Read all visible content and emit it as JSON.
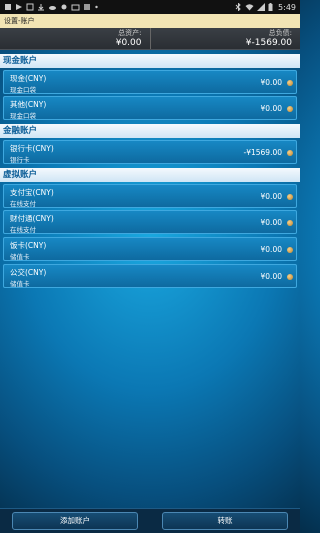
{
  "status_bar": {
    "time": "5:49"
  },
  "title": "设置-账户",
  "summary": {
    "assets_label": "总资产:",
    "assets_value": "¥0.00",
    "liabilities_label": "总负债:",
    "liabilities_value": "¥-1569.00"
  },
  "sections": [
    {
      "title": "现金账户",
      "items": [
        {
          "name": "现金(CNY)",
          "sub": "现金口袋",
          "amount": "¥0.00"
        },
        {
          "name": "其他(CNY)",
          "sub": "现金口袋",
          "amount": "¥0.00"
        }
      ]
    },
    {
      "title": "金融账户",
      "items": [
        {
          "name": "银行卡(CNY)",
          "sub": "银行卡",
          "amount": "-¥1569.00"
        }
      ]
    },
    {
      "title": "虚拟账户",
      "items": [
        {
          "name": "支付宝(CNY)",
          "sub": "在线支付",
          "amount": "¥0.00"
        },
        {
          "name": "财付通(CNY)",
          "sub": "在线支付",
          "amount": "¥0.00"
        },
        {
          "name": "饭卡(CNY)",
          "sub": "储值卡",
          "amount": "¥0.00"
        },
        {
          "name": "公交(CNY)",
          "sub": "储值卡",
          "amount": "¥0.00"
        }
      ]
    }
  ],
  "buttons": {
    "add": "添加账户",
    "transfer": "转账"
  },
  "colors": {
    "accent": "#f2e4b4",
    "section_text": "#0b5d97",
    "row_bg": "#1788c4"
  }
}
